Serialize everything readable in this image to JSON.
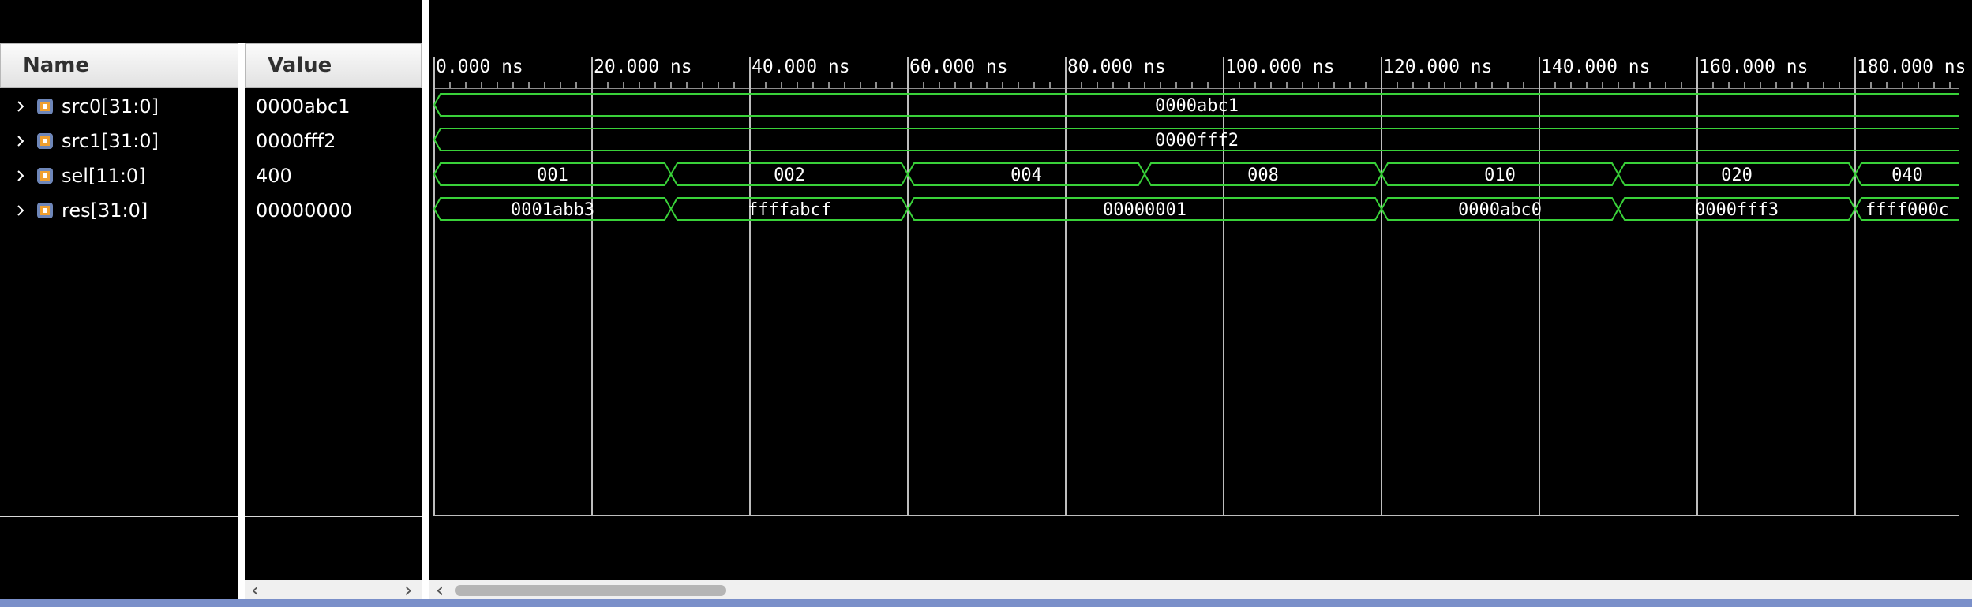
{
  "headers": {
    "name": "Name",
    "value": "Value"
  },
  "signals": [
    {
      "name": "src0[31:0]",
      "value": "0000abc1"
    },
    {
      "name": "src1[31:0]",
      "value": "0000fff2"
    },
    {
      "name": "sel[11:0]",
      "value": "400"
    },
    {
      "name": "res[31:0]",
      "value": "00000000"
    }
  ],
  "time_ruler": {
    "unit": "ns",
    "labels": [
      "0.000 ns",
      "20.000 ns",
      "40.000 ns",
      "60.000 ns",
      "80.000 ns",
      "100.000 ns",
      "120.000 ns",
      "140.000 ns",
      "160.000 ns",
      "180.000 ns"
    ]
  },
  "waveforms": [
    {
      "signal": "src0[31:0]",
      "segments": [
        {
          "start": 0,
          "end": 194,
          "label": "0000abc1"
        }
      ]
    },
    {
      "signal": "src1[31:0]",
      "segments": [
        {
          "start": 0,
          "end": 194,
          "label": "0000fff2"
        }
      ]
    },
    {
      "signal": "sel[11:0]",
      "segments": [
        {
          "start": 0,
          "end": 30,
          "label": "001"
        },
        {
          "start": 30,
          "end": 60,
          "label": "002"
        },
        {
          "start": 60,
          "end": 90,
          "label": "004"
        },
        {
          "start": 90,
          "end": 120,
          "label": "008"
        },
        {
          "start": 120,
          "end": 150,
          "label": "010"
        },
        {
          "start": 150,
          "end": 180,
          "label": "020"
        },
        {
          "start": 180,
          "end": 194,
          "label": "040"
        }
      ]
    },
    {
      "signal": "res[31:0]",
      "segments": [
        {
          "start": 0,
          "end": 30,
          "label": "0001abb3"
        },
        {
          "start": 30,
          "end": 60,
          "label": "ffffabcf"
        },
        {
          "start": 60,
          "end": 120,
          "label": "00000001"
        },
        {
          "start": 120,
          "end": 150,
          "label": "0000abc0"
        },
        {
          "start": 150,
          "end": 180,
          "label": "0000fff3"
        },
        {
          "start": 180,
          "end": 194,
          "label": "ffff000c"
        }
      ]
    }
  ],
  "colors": {
    "wave": "#39d139",
    "grid": "#bdbdbd",
    "background": "#000000"
  },
  "icons": {
    "expand": "chevron-right-icon",
    "bus": "bus-signal-icon",
    "scroll_left": "chevron-left-icon",
    "scroll_right": "chevron-right-icon"
  }
}
